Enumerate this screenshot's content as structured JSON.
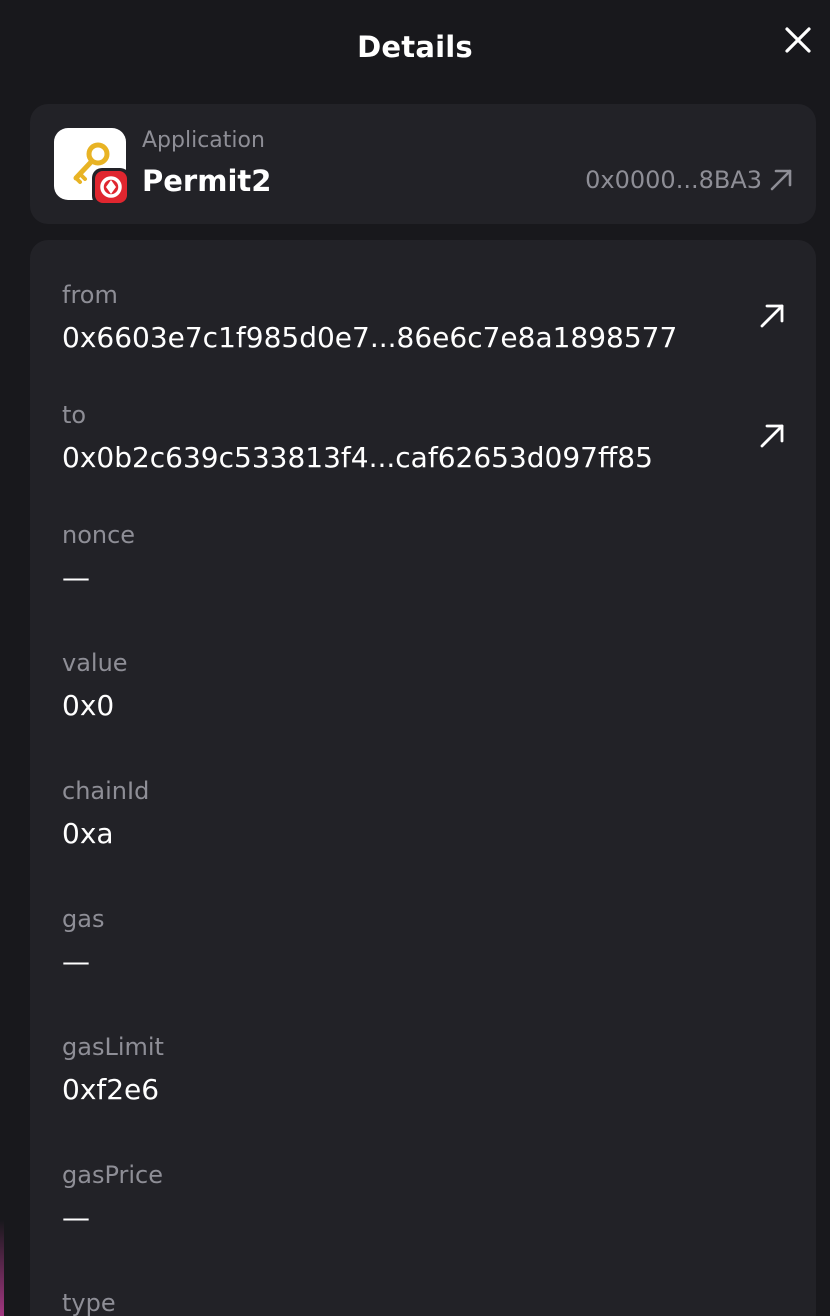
{
  "header": {
    "title": "Details",
    "close_icon": "close-icon"
  },
  "application": {
    "label": "Application",
    "name": "Permit2",
    "address": "0x0000...8BA3",
    "icon": "key-icon",
    "badge_icon": "network-badge-icon"
  },
  "fields": [
    {
      "label": "from",
      "value": "0x6603e7c1f985d0e7...86e6c7e8a1898577",
      "link_icon": "external-link-icon"
    },
    {
      "label": "to",
      "value": "0x0b2c639c533813f4...caf62653d097ff85",
      "link_icon": "external-link-icon"
    },
    {
      "label": "nonce",
      "value": "—"
    },
    {
      "label": "value",
      "value": "0x0"
    },
    {
      "label": "chainId",
      "value": "0xa"
    },
    {
      "label": "gas",
      "value": "—"
    },
    {
      "label": "gasLimit",
      "value": "0xf2e6"
    },
    {
      "label": "gasPrice",
      "value": "—"
    },
    {
      "label": "type",
      "value": ""
    }
  ],
  "colors": {
    "background": "#18181c",
    "card": "#222227",
    "muted_text": "#8e8e96",
    "badge_red": "#e0262f",
    "edge_accent": "#b23a8c"
  }
}
